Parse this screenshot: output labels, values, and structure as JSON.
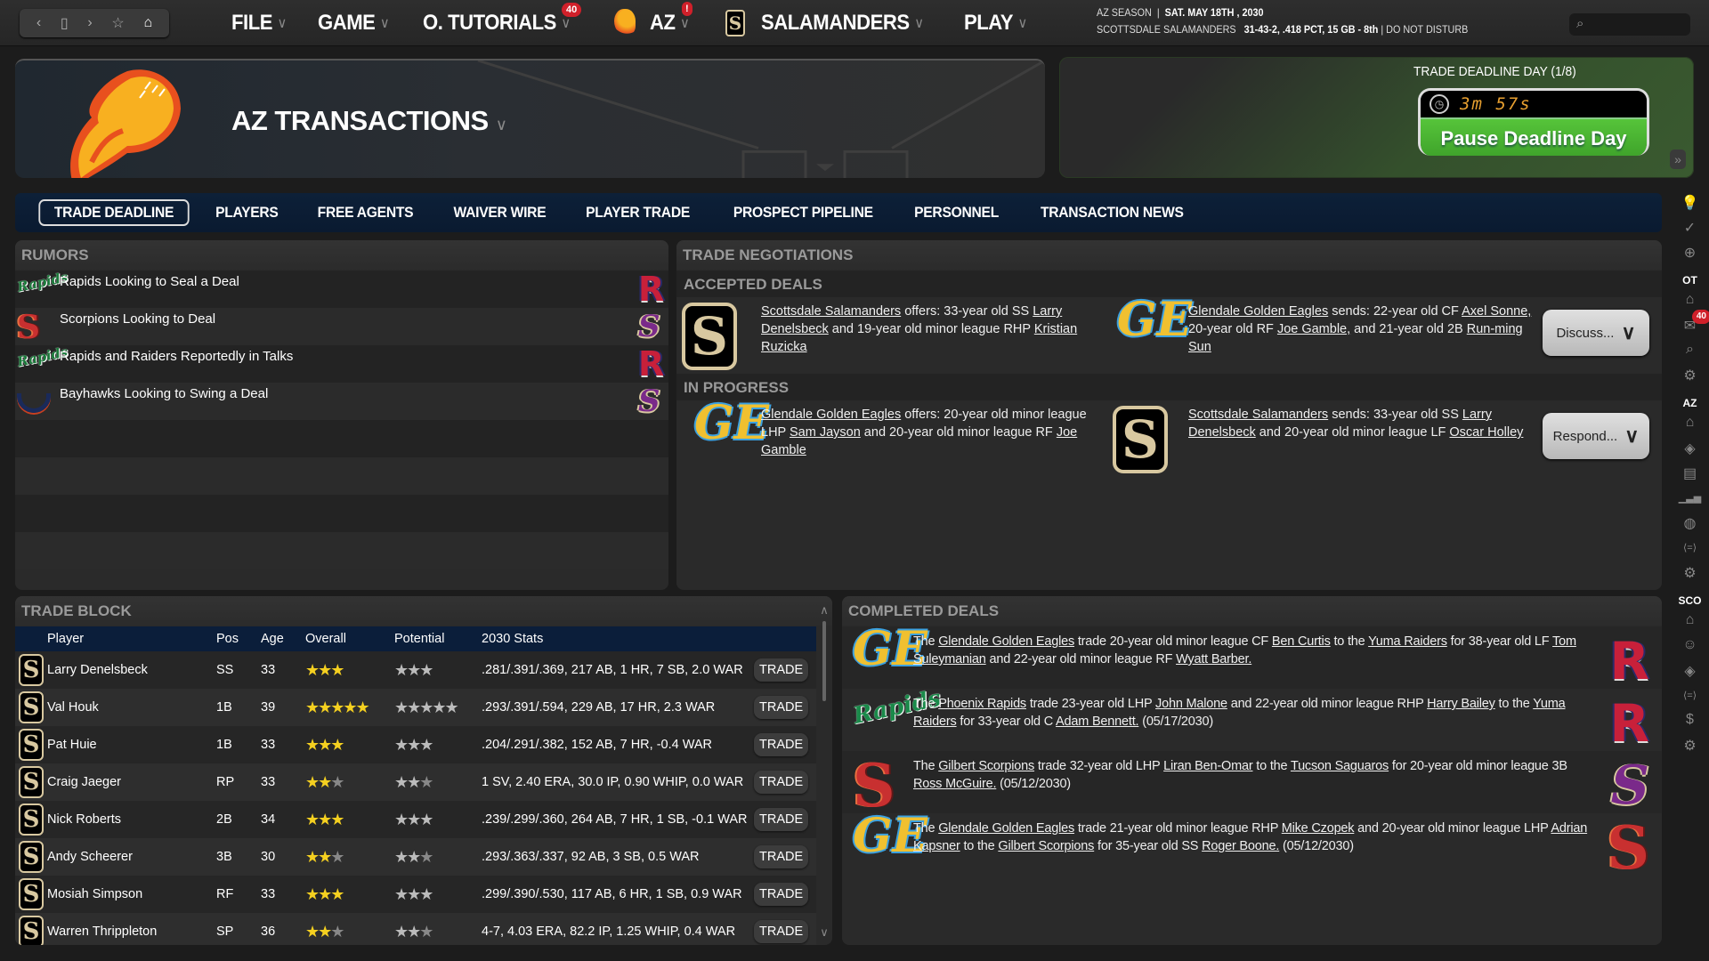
{
  "topbar": {
    "nav_icons": [
      "back-icon",
      "window-icon",
      "forward-icon",
      "star-icon",
      "home-icon"
    ],
    "menus": [
      {
        "label": "FILE"
      },
      {
        "label": "GAME"
      },
      {
        "label": "O. TUTORIALS",
        "badge": "40"
      },
      {
        "label": "AZ",
        "badge": "!"
      },
      {
        "label": "SALAMANDERS"
      },
      {
        "label": "PLAY"
      }
    ],
    "status_line1_a": "AZ SEASON",
    "status_line1_b": "SAT. MAY 18TH , 2030",
    "status_line2_team": "SCOTTSDALE SALAMANDERS",
    "status_line2_record": "31-43-2, .418 PCT, 15 GB - 8th",
    "status_line2_mode": "DO NOT DISTURB",
    "search_placeholder": ""
  },
  "header": {
    "title": "AZ TRANSACTIONS"
  },
  "deadline": {
    "title": "TRADE DEADLINE DAY (1/8)",
    "timer": "3m 57s",
    "pause_label": "Pause Deadline Day",
    "expand_icon": "»"
  },
  "tabs": [
    "TRADE DEADLINE",
    "PLAYERS",
    "FREE AGENTS",
    "WAIVER WIRE",
    "PLAYER TRADE",
    "PROSPECT PIPELINE",
    "PERSONNEL",
    "TRANSACTION NEWS"
  ],
  "rumors": {
    "title": "RUMORS",
    "items": [
      {
        "text": "Rapids Looking to Seal a Deal",
        "left": "rapids",
        "right": "raiders"
      },
      {
        "text": "Scorpions Looking to Deal",
        "left": "scorpions",
        "right": "saguaros"
      },
      {
        "text": "Rapids and Raiders Reportedly in Talks",
        "left": "rapids",
        "right": "raiders"
      },
      {
        "text": "Bayhawks Looking to Swing a Deal",
        "left": "bayhawks",
        "right": "saguaros"
      }
    ]
  },
  "negotiations": {
    "title": "TRADE NEGOTIATIONS",
    "accepted_label": "ACCEPTED DEALS",
    "in_progress_label": "IN PROGRESS",
    "accepted": {
      "offer_team": "Scottsdale Salamanders",
      "offer_text_1": " offers: 33-year old SS ",
      "offer_p1": "Larry Denelsbeck",
      "offer_text_2": " and 19-year old minor league RHP ",
      "offer_p2": "Kristian Ruzicka",
      "send_team": "Glendale Golden Eagles",
      "send_text_1": " sends: 22-year old CF ",
      "send_p1": "Axel Sonne,",
      "send_text_2": " 20-year old RF ",
      "send_p2": "Joe Gamble,",
      "send_text_3": " and 21-year old 2B ",
      "send_p3": "Run-ming Sun",
      "button": "Discuss..."
    },
    "in_progress": {
      "offer_team": "Glendale Golden Eagles",
      "offer_text_1": " offers: 20-year old minor league LHP ",
      "offer_p1": "Sam Jayson",
      "offer_text_2": " and 20-year old minor league RF ",
      "offer_p2": "Joe Gamble",
      "send_team": "Scottsdale Salamanders",
      "send_text_1": " sends: 33-year old SS ",
      "send_p1": "Larry Denelsbeck",
      "send_text_2": " and 20-year old minor league LF ",
      "send_p2": "Oscar Holley",
      "button": "Respond..."
    }
  },
  "trade_block": {
    "title": "TRADE BLOCK",
    "columns": [
      "Player",
      "Pos",
      "Age",
      "Overall",
      "Potential",
      "2030 Stats"
    ],
    "button_label": "TRADE",
    "rows": [
      {
        "name": "Larry Denelsbeck",
        "pos": "SS",
        "age": "33",
        "overall": 3,
        "potential": 3,
        "stats": ".281/.391/.369, 217 AB, 1 HR, 7 SB, 2.0 WAR"
      },
      {
        "name": "Val Houk",
        "pos": "1B",
        "age": "39",
        "overall": 5,
        "potential": 5,
        "stats": ".293/.391/.594, 229 AB, 17 HR, 2.3 WAR"
      },
      {
        "name": "Pat Huie",
        "pos": "1B",
        "age": "33",
        "overall": 3,
        "potential": 3,
        "stats": ".204/.291/.382, 152 AB, 7 HR, -0.4 WAR"
      },
      {
        "name": "Craig Jaeger",
        "pos": "RP",
        "age": "33",
        "overall": 2.5,
        "potential": 2.5,
        "stats": "1 SV, 2.40 ERA, 30.0 IP, 0.90 WHIP, 0.0 WAR"
      },
      {
        "name": "Nick Roberts",
        "pos": "2B",
        "age": "34",
        "overall": 3,
        "potential": 3,
        "stats": ".239/.299/.360, 264 AB, 7 HR, 1 SB, -0.1 WAR"
      },
      {
        "name": "Andy Scheerer",
        "pos": "3B",
        "age": "30",
        "overall": 2.5,
        "potential": 2.5,
        "stats": ".293/.363/.337, 92 AB, 3 SB, 0.5 WAR"
      },
      {
        "name": "Mosiah Simpson",
        "pos": "RF",
        "age": "33",
        "overall": 3,
        "potential": 3,
        "stats": ".299/.390/.530, 117 AB, 6 HR, 1 SB, 0.9 WAR"
      },
      {
        "name": "Warren Thrippleton",
        "pos": "SP",
        "age": "36",
        "overall": 2.5,
        "potential": 2.5,
        "stats": "4-7, 4.03 ERA, 82.2 IP, 1.25 WHIP, 0.4 WAR"
      }
    ]
  },
  "completed": {
    "title": "COMPLETED DEALS",
    "items": [
      {
        "left": "golden-eagles",
        "right": "raiders",
        "parts": [
          [
            "The ",
            0
          ],
          [
            "Glendale Golden Eagles",
            1
          ],
          [
            " trade 20-year old minor league CF ",
            0
          ],
          [
            "Ben Curtis",
            1
          ],
          [
            " to the ",
            0
          ],
          [
            "Yuma Raiders",
            1
          ],
          [
            " for 38-year old LF ",
            0
          ],
          [
            "Tom Suleymanian",
            1
          ],
          [
            " and 22-year old minor league RF ",
            0
          ],
          [
            "Wyatt Barber.",
            1
          ]
        ]
      },
      {
        "left": "rapids",
        "right": "raiders",
        "parts": [
          [
            "The ",
            0
          ],
          [
            "Phoenix Rapids",
            1
          ],
          [
            " trade 23-year old LHP ",
            0
          ],
          [
            "John Malone",
            1
          ],
          [
            " and 22-year old minor league RHP ",
            0
          ],
          [
            "Harry Bailey",
            1
          ],
          [
            " to the ",
            0
          ],
          [
            "Yuma Raiders",
            1
          ],
          [
            " for 33-year old C ",
            0
          ],
          [
            "Adam Bennett.",
            1
          ],
          [
            " (05/17/2030)",
            0
          ]
        ]
      },
      {
        "left": "scorpions",
        "right": "saguaros",
        "parts": [
          [
            "The ",
            0
          ],
          [
            "Gilbert Scorpions",
            1
          ],
          [
            " trade 32-year old LHP ",
            0
          ],
          [
            "Liran Ben-Omar",
            1
          ],
          [
            " to the ",
            0
          ],
          [
            "Tucson Saguaros",
            1
          ],
          [
            " for 20-year old minor league 3B ",
            0
          ],
          [
            "Ross McGuire.",
            1
          ],
          [
            " (05/12/2030)",
            0
          ]
        ]
      },
      {
        "left": "golden-eagles",
        "right": "scorpions",
        "parts": [
          [
            "The ",
            0
          ],
          [
            "Glendale Golden Eagles",
            1
          ],
          [
            " trade 21-year old minor league RHP ",
            0
          ],
          [
            "Mike Czopek",
            1
          ],
          [
            " and 20-year old minor league LHP ",
            0
          ],
          [
            "Adrian Kapsner",
            1
          ],
          [
            " to the ",
            0
          ],
          [
            "Gilbert Scorpions",
            1
          ],
          [
            " for 35-year old SS ",
            0
          ],
          [
            "Roger Boone.",
            1
          ],
          [
            " (05/12/2030)",
            0
          ]
        ]
      }
    ]
  },
  "sidebar": {
    "items": [
      {
        "icon": "lightbulb-icon",
        "glyph": "💡"
      },
      {
        "icon": "check-icon",
        "glyph": "✓"
      },
      {
        "icon": "globe-icon",
        "glyph": "⊕"
      },
      {
        "label": "OT"
      },
      {
        "icon": "home-icon",
        "glyph": "⌂"
      },
      {
        "icon": "mail-icon",
        "glyph": "✉",
        "badge": "40"
      },
      {
        "icon": "search-icon",
        "glyph": "⌕"
      },
      {
        "icon": "gear-icon",
        "glyph": "⚙"
      },
      {
        "label": "AZ"
      },
      {
        "icon": "home-icon",
        "glyph": "⌂"
      },
      {
        "icon": "diamond-icon",
        "glyph": "◈"
      },
      {
        "icon": "id-card-icon",
        "glyph": "▤"
      },
      {
        "icon": "bar-chart-icon",
        "glyph": "▁▃▅"
      },
      {
        "icon": "baseball-icon",
        "glyph": "◍"
      },
      {
        "icon": "trade-icon",
        "glyph": "⟨=⟩"
      },
      {
        "icon": "gear-icon",
        "glyph": "⚙"
      },
      {
        "label": "SCO"
      },
      {
        "icon": "home-icon",
        "glyph": "⌂"
      },
      {
        "icon": "coach-icon",
        "glyph": "☺"
      },
      {
        "icon": "diamond-icon",
        "glyph": "◈"
      },
      {
        "icon": "trade-icon",
        "glyph": "⟨=⟩"
      },
      {
        "icon": "dollar-icon",
        "glyph": "$"
      },
      {
        "icon": "gear-icon",
        "glyph": "⚙"
      }
    ]
  }
}
